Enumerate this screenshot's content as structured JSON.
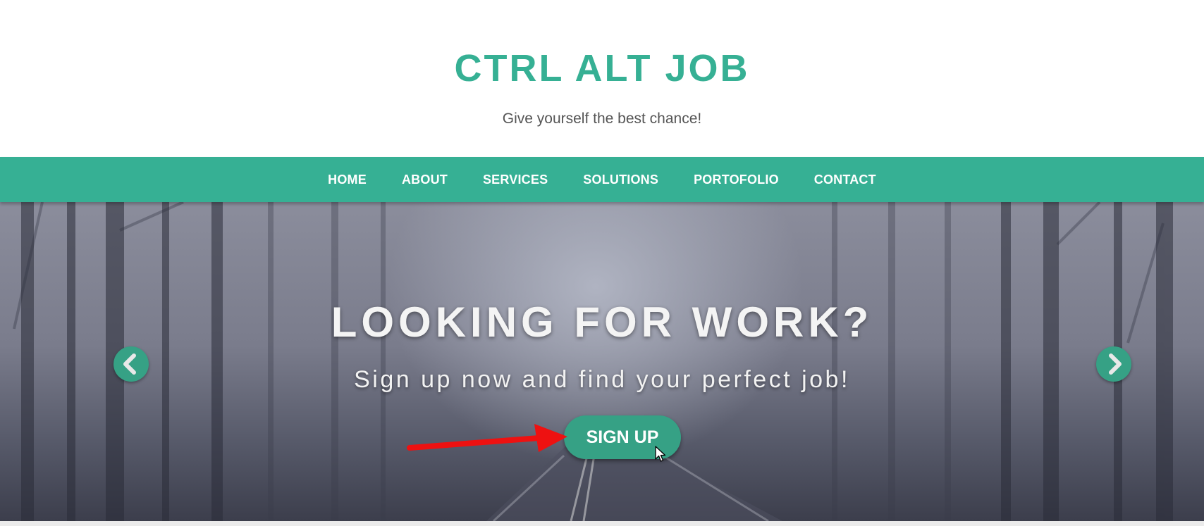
{
  "site": {
    "title": "CTRL ALT JOB",
    "tagline": "Give yourself the best chance!"
  },
  "nav": {
    "items": [
      {
        "label": "HOME"
      },
      {
        "label": "ABOUT"
      },
      {
        "label": "SERVICES"
      },
      {
        "label": "SOLUTIONS"
      },
      {
        "label": "PORTOFOLIO"
      },
      {
        "label": "CONTACT"
      }
    ]
  },
  "hero": {
    "heading": "LOOKING FOR WORK?",
    "subheading": "Sign up now and find your perfect job!",
    "cta_label": "SIGN UP",
    "prev_icon": "chevron-left-icon",
    "next_icon": "chevron-right-icon"
  },
  "annotation": {
    "icon": "red-arrow-icon",
    "color": "#ee1111"
  },
  "colors": {
    "accent": "#36b094",
    "button": "#36a185",
    "hero_text": "#f4f4f4"
  }
}
